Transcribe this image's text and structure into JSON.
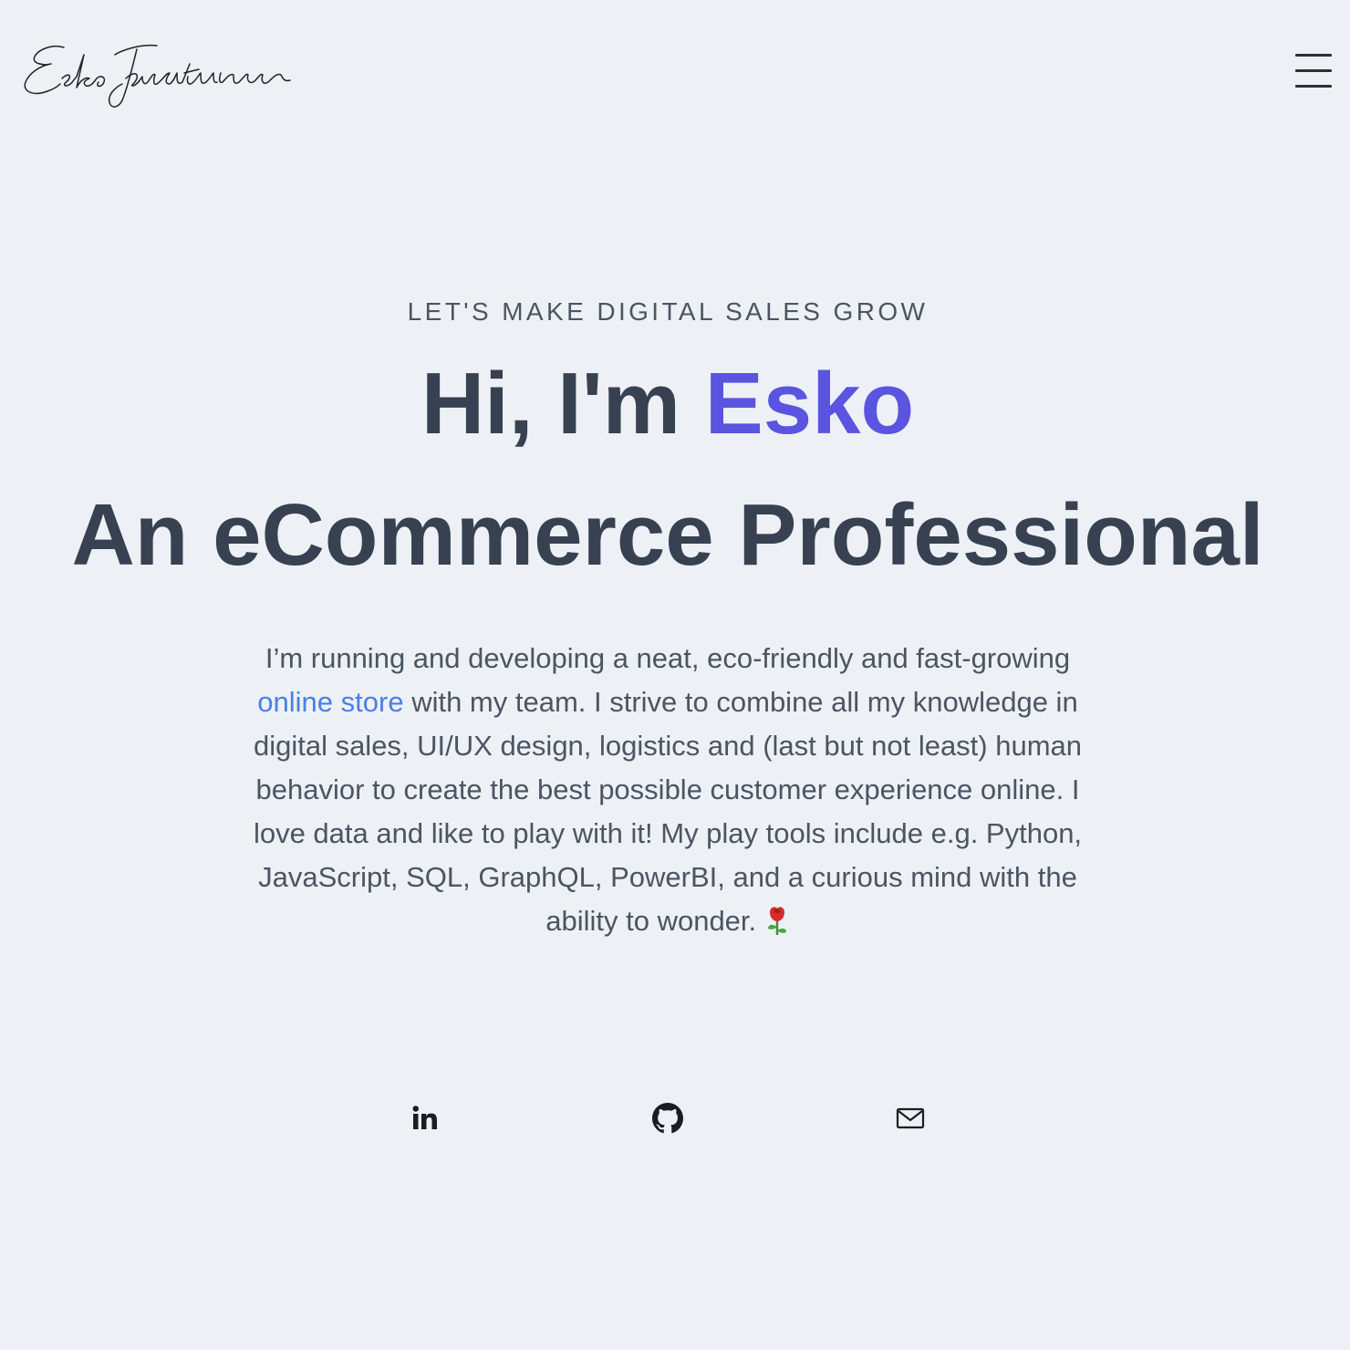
{
  "header": {
    "logo_text": "Esko Janatuinen",
    "menu_icon": "hamburger-menu-icon"
  },
  "hero": {
    "eyebrow": "LET'S MAKE DIGITAL SALES GROW",
    "greeting_prefix": "Hi, I'm ",
    "greeting_name": "Esko",
    "title": "An eCommerce Professional",
    "bio_before_link": "I’m running and developing a neat, eco-friendly and fast-growing ",
    "bio_link": "online store",
    "bio_after_link": " with my team. I strive to combine all my knowledge in digital sales, UI/UX design, logistics and (last but not least) human behavior to create the best possible customer experience online. I love data and like to play with it! My play tools include e.g. Python, JavaScript, SQL, GraphQL, PowerBI, and a curious mind with the ability to wonder. ",
    "bio_emoji_icon": "rose-icon"
  },
  "social": {
    "icons": [
      "linkedin-icon",
      "github-icon",
      "mail-icon"
    ]
  },
  "colors": {
    "background": "#edf1f5",
    "text": "#374151",
    "accent": "#5a54e0",
    "link": "#4a7fe6"
  }
}
